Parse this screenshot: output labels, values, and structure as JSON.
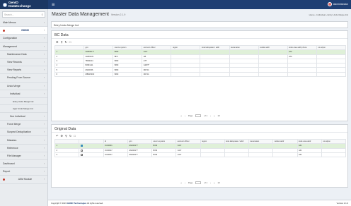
{
  "brand": {
    "line1": "GenIO",
    "line2": "DataExchange"
  },
  "user": {
    "name": "Administrator"
  },
  "search": {
    "placeholder": "Search..."
  },
  "sidebar": {
    "items": [
      {
        "label": "Main Menus",
        "level": 0
      },
      {
        "label": "GMDM",
        "level": 0,
        "active": true
      },
      {
        "label": "Configuration",
        "level": 0
      },
      {
        "label": "Management",
        "level": 0
      },
      {
        "label": "Maintenance Data",
        "level": 1
      },
      {
        "label": "View Records",
        "level": 1
      },
      {
        "label": "View Reports",
        "level": 1
      },
      {
        "label": "Pending From Source",
        "level": 1
      },
      {
        "label": "Undo Merge",
        "level": 1
      },
      {
        "label": "Individual",
        "level": 2
      },
      {
        "label": "Entry Undo Merge Ind",
        "level": 3
      },
      {
        "label": "Appr Undo Merge Ind",
        "level": 3
      },
      {
        "label": "Non Individual",
        "level": 2
      },
      {
        "label": "Force Merge",
        "level": 1
      },
      {
        "label": "Suspect Deduplication",
        "level": 1
      },
      {
        "label": "Mistakes",
        "level": 1
      },
      {
        "label": "Reference",
        "level": 1
      },
      {
        "label": "File Manager",
        "level": 1
      },
      {
        "label": "Dashboard",
        "level": 0
      },
      {
        "label": "Report",
        "level": 0
      },
      {
        "label": "ASM Module",
        "level": 0
      }
    ]
  },
  "page": {
    "title": "Master Data Management",
    "version": "Version 2.1.9",
    "breadcrumb": "Home › Individual › Entry Undo Merge Ind",
    "subtitle": "Entry Undo Merge Ind"
  },
  "bc": {
    "title": "BC Data",
    "columns": [
      "",
      "gcn",
      "source system",
      "account officer",
      "region",
      "kota kabupaten / addr",
      "kecamatan",
      "celular addr",
      "kode area addr phone",
      "no.telpon"
    ],
    "rows": [
      [
        "1",
        "GM0001*7",
        "BXM",
        "GGT",
        "",
        "",
        "",
        "",
        "GM",
        ""
      ],
      [
        "2",
        "GM00233",
        "BFX",
        "AB",
        "",
        "",
        "",
        "",
        "GM",
        ""
      ],
      [
        "3",
        "TBD0104",
        "BXM",
        "ATT",
        "",
        "",
        "",
        "",
        "",
        ""
      ],
      [
        "4",
        "BXM1111",
        "BXM",
        "GM0T*",
        "",
        "",
        "",
        "",
        "",
        ""
      ],
      [
        "5",
        "M130456",
        "BXM",
        "R0744",
        "",
        "",
        "",
        "",
        "",
        ""
      ],
      [
        "6",
        "MB015000",
        "BXM",
        "R0744",
        "",
        "",
        "",
        "",
        "",
        ""
      ]
    ],
    "pager": {
      "page": "Page",
      "of": "of 1",
      "size": "10"
    }
  },
  "orig": {
    "title": "Original Data",
    "columns": [
      "",
      "",
      "id",
      "gcn",
      "source system",
      "account officer",
      "region",
      "kota kabupaten / addr",
      "kecamatan",
      "celular addr",
      "kode area addr",
      "no.telpon"
    ],
    "rows": [
      [
        "1",
        "on",
        "FC00001",
        "GM0001*7",
        "BXM",
        "GGT",
        "",
        "",
        "",
        "",
        "GM",
        ""
      ],
      [
        "2",
        "off",
        "FC00017",
        "GM0001*7",
        "BXM",
        "GGT",
        "",
        "",
        "",
        "",
        "GM",
        ""
      ],
      [
        "3",
        "off",
        "FC00017",
        "GM0001*7",
        "BXM",
        "GGT",
        "",
        "",
        "",
        "",
        "GM",
        ""
      ]
    ],
    "pager": {
      "page": "Page",
      "of": "of 1",
      "size": "10"
    }
  },
  "footer": {
    "copy": "Copyright © 2023",
    "company": "GENIO Technologies",
    "rights": "All rights reserved.",
    "version": "Version 2.1.9"
  },
  "colors": {
    "topbar": "#1f3f73",
    "selected_row": "#dff0d8",
    "accent": "#3c8dbc"
  }
}
